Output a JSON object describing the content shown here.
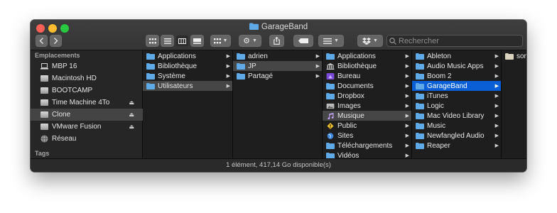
{
  "window": {
    "title": "GarageBand"
  },
  "toolbar": {
    "back_icon": "chevron-left-icon",
    "forward_icon": "chevron-right-icon",
    "view_modes": [
      "icon-view",
      "list-view",
      "column-view",
      "gallery-view"
    ],
    "group_icon": "group-icon",
    "action_icon": "gear-icon",
    "share_icon": "share-icon",
    "tags_icon": "tag-icon",
    "arrange_icon": "arrange-icon",
    "dropbox_icon": "dropbox-icon",
    "search_placeholder": "Rechercher"
  },
  "sidebar": {
    "locations_label": "Emplacements",
    "items": [
      {
        "label": "MBP 16",
        "icon": "laptop-icon"
      },
      {
        "label": "Macintosh HD",
        "icon": "disk-icon"
      },
      {
        "label": "BOOTCAMP",
        "icon": "disk-icon"
      },
      {
        "label": "Time Machine 4To",
        "icon": "disk-icon",
        "eject": true
      },
      {
        "label": "Clone",
        "icon": "disk-icon",
        "eject": true,
        "selected": true
      },
      {
        "label": "VMware Fusion",
        "icon": "disk-icon",
        "eject": true
      },
      {
        "label": "Réseau",
        "icon": "network-icon"
      }
    ],
    "tags_label": "Tags"
  },
  "columns": [
    {
      "items": [
        {
          "label": "Applications"
        },
        {
          "label": "Bibliothèque"
        },
        {
          "label": "Système"
        },
        {
          "label": "Utilisateurs",
          "selected": true
        }
      ]
    },
    {
      "items": [
        {
          "label": "adrien"
        },
        {
          "label": "JP",
          "selected": true
        },
        {
          "label": "Partagé"
        }
      ]
    },
    {
      "items": [
        {
          "label": "Applications"
        },
        {
          "label": "Bibliothèque"
        },
        {
          "label": "Bureau"
        },
        {
          "label": "Documents"
        },
        {
          "label": "Dropbox"
        },
        {
          "label": "Images"
        },
        {
          "label": "Musique",
          "selected": true
        },
        {
          "label": "Public"
        },
        {
          "label": "Sites"
        },
        {
          "label": "Téléchargements"
        },
        {
          "label": "Vidéos"
        }
      ]
    },
    {
      "items": [
        {
          "label": "Ableton"
        },
        {
          "label": "Audio Music Apps"
        },
        {
          "label": "Boom 2"
        },
        {
          "label": "GarageBand",
          "selected": true
        },
        {
          "label": "iTunes"
        },
        {
          "label": "Logic"
        },
        {
          "label": "Mac Video Library"
        },
        {
          "label": "Music"
        },
        {
          "label": "Newfangled Audio"
        },
        {
          "label": "Reaper"
        }
      ]
    },
    {
      "items": [
        {
          "label": "son"
        }
      ]
    }
  ],
  "status": {
    "text": "1 élément, 417,14 Go disponible(s)"
  },
  "colors": {
    "accent": "#0a5fd6",
    "folder": "#5fa9e6"
  }
}
